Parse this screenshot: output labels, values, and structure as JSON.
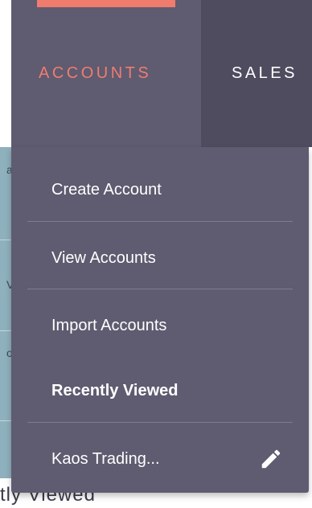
{
  "nav": {
    "tabs": [
      {
        "label": "ACCOUNTS",
        "active": true
      },
      {
        "label": "SALES",
        "active": false
      }
    ]
  },
  "dropdown": {
    "items": [
      {
        "label": "Create Account"
      },
      {
        "label": "View Accounts"
      },
      {
        "label": "Import Accounts"
      }
    ],
    "recently_viewed": {
      "header": "Recently Viewed",
      "items": [
        {
          "label": "Kaos Trading...",
          "icon": "pencil-icon"
        }
      ]
    }
  },
  "background": {
    "partial_text": "tly Viewed",
    "side_glyphs": [
      "a",
      "V",
      "o"
    ]
  },
  "colors": {
    "nav_bg": "#5c5a6e",
    "active_tab_text": "#ee7d71",
    "active_tab_bar": "#f07c6d",
    "dropdown_bg": "#5f5b70",
    "side_strip": "#8fb0bd"
  }
}
